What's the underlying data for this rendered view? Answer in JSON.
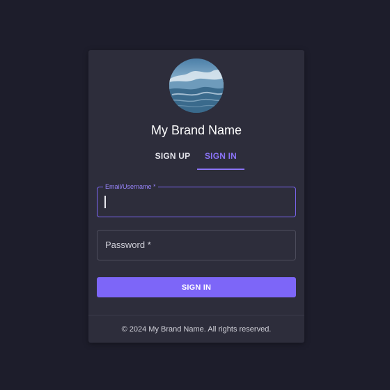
{
  "brand": {
    "name": "My Brand Name",
    "avatar_icon": "mountain-lake-photo"
  },
  "tabs": [
    {
      "label": "SIGN UP",
      "active": false
    },
    {
      "label": "SIGN IN",
      "active": true
    }
  ],
  "form": {
    "email": {
      "label": "Email/Username *",
      "value": "",
      "focused": true
    },
    "password": {
      "placeholder": "Password *",
      "value": ""
    },
    "submit_label": "SIGN IN"
  },
  "footer": {
    "text": "© 2024 My Brand Name. All rights reserved."
  },
  "colors": {
    "background": "#1d1d2b",
    "card": "#2d2d3b",
    "accent": "#7d66f8"
  }
}
